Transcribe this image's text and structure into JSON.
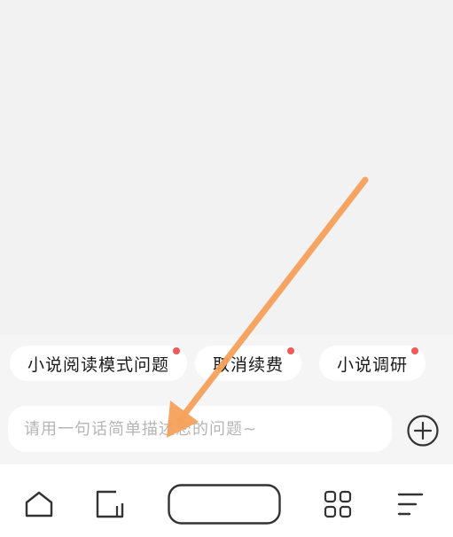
{
  "suggestions": [
    {
      "label": "小说阅读模式问题",
      "has_dot": true
    },
    {
      "label": "取消续费",
      "has_dot": true
    },
    {
      "label": "小说调研",
      "has_dot": true
    }
  ],
  "question_input": {
    "placeholder": "请用一句话简单描述您的问题~",
    "value": ""
  },
  "icons": {
    "add": "plus-circle-icon",
    "home": "home-icon",
    "tabs": "tabs-icon",
    "apps": "grid-icon",
    "menu": "menu-icon",
    "annotation": "orange-arrow-overlay"
  },
  "colors": {
    "dot": "#f05a5a",
    "arrow": "#f6a15a",
    "panel": "#f5f5f5",
    "chip": "#ffffff"
  }
}
